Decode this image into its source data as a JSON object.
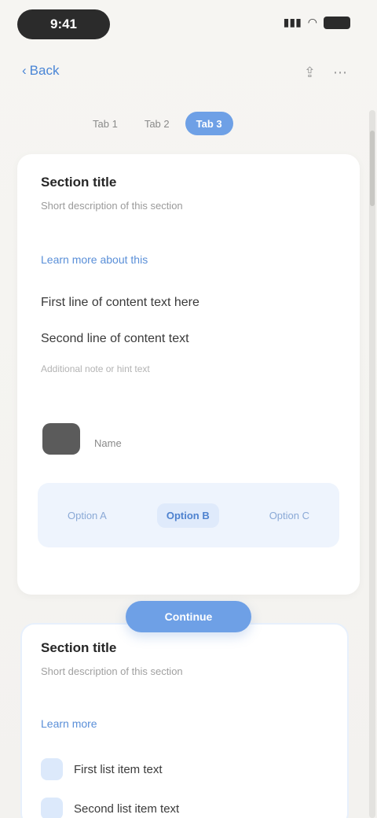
{
  "status": {
    "time": "9:41"
  },
  "nav": {
    "back_label": "Back"
  },
  "tabs": [
    {
      "label": "Tab 1"
    },
    {
      "label": "Tab 2"
    },
    {
      "label": "Tab 3"
    }
  ],
  "card": {
    "title": "Section title",
    "subtitle": "Short description of this section",
    "link": "Learn more about this",
    "line1": "First line of content text here",
    "line2": "Second line of content text",
    "hint": "Additional note or hint text",
    "avatar_label": "Name",
    "choices": [
      {
        "label": "Option A"
      },
      {
        "label": "Option B"
      },
      {
        "label": "Option C"
      }
    ]
  },
  "primary_button": {
    "label": "Continue"
  },
  "card2": {
    "title": "Section title",
    "subtitle": "Short description of this section",
    "link": "Learn more",
    "items": [
      {
        "label": "First list item text"
      },
      {
        "label": "Second list item text"
      }
    ]
  },
  "colors": {
    "accent": "#6ea0e6",
    "link": "#5a8fd8",
    "background": "#f3f2ef"
  }
}
